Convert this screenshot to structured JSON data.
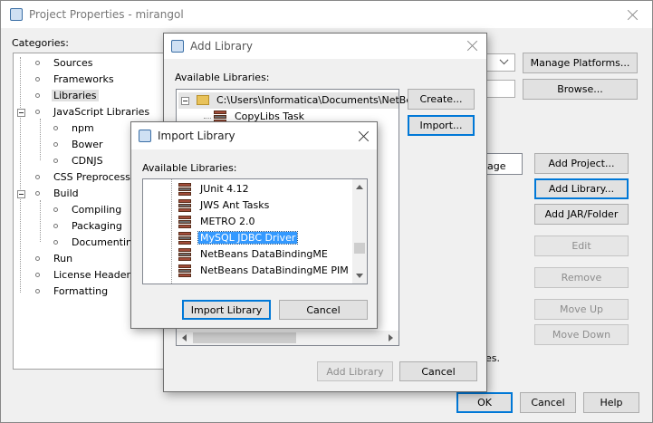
{
  "main_window": {
    "title": "Project Properties - mirangol",
    "categories_label": "Categories:",
    "tree": [
      "Sources",
      "Frameworks",
      "Libraries",
      "JavaScript Libraries",
      "npm",
      "Bower",
      "CDNJS",
      "CSS Preprocessors",
      "Build",
      "Compiling",
      "Packaging",
      "Documenting",
      "Run",
      "License Headers",
      "Formatting"
    ],
    "manage_platforms": "Manage Platforms...",
    "browse": "Browse...",
    "list_fragment": "age",
    "side_buttons": [
      "Add Project...",
      "Add Library...",
      "Add JAR/Folder",
      "Edit",
      "Remove",
      "Move Up",
      "Move Down"
    ],
    "bottom_fragment": "es.",
    "ok": "OK",
    "cancel": "Cancel",
    "help": "Help"
  },
  "add_library": {
    "title": "Add Library",
    "available_label": "Available Libraries:",
    "root_path": "C:\\Users\\Informatica\\Documents\\NetBea",
    "first_child": "CopyLibs Task",
    "create": "Create...",
    "import": "Import...",
    "add_library_btn": "Add Library",
    "cancel": "Cancel"
  },
  "import_library": {
    "title": "Import Library",
    "available_label": "Available Libraries:",
    "items": [
      "JUnit 4.12",
      "JWS Ant Tasks",
      "METRO 2.0",
      "MySQL JDBC Driver",
      "NetBeans DataBindingME",
      "NetBeans DataBindingME PIM"
    ],
    "selected_index": 3,
    "import_btn": "Import Library",
    "cancel": "Cancel"
  },
  "colors": {
    "selection": "#3399ff",
    "focus_border": "#0078d7",
    "selected_tree_bg": "#e0e0e0"
  }
}
